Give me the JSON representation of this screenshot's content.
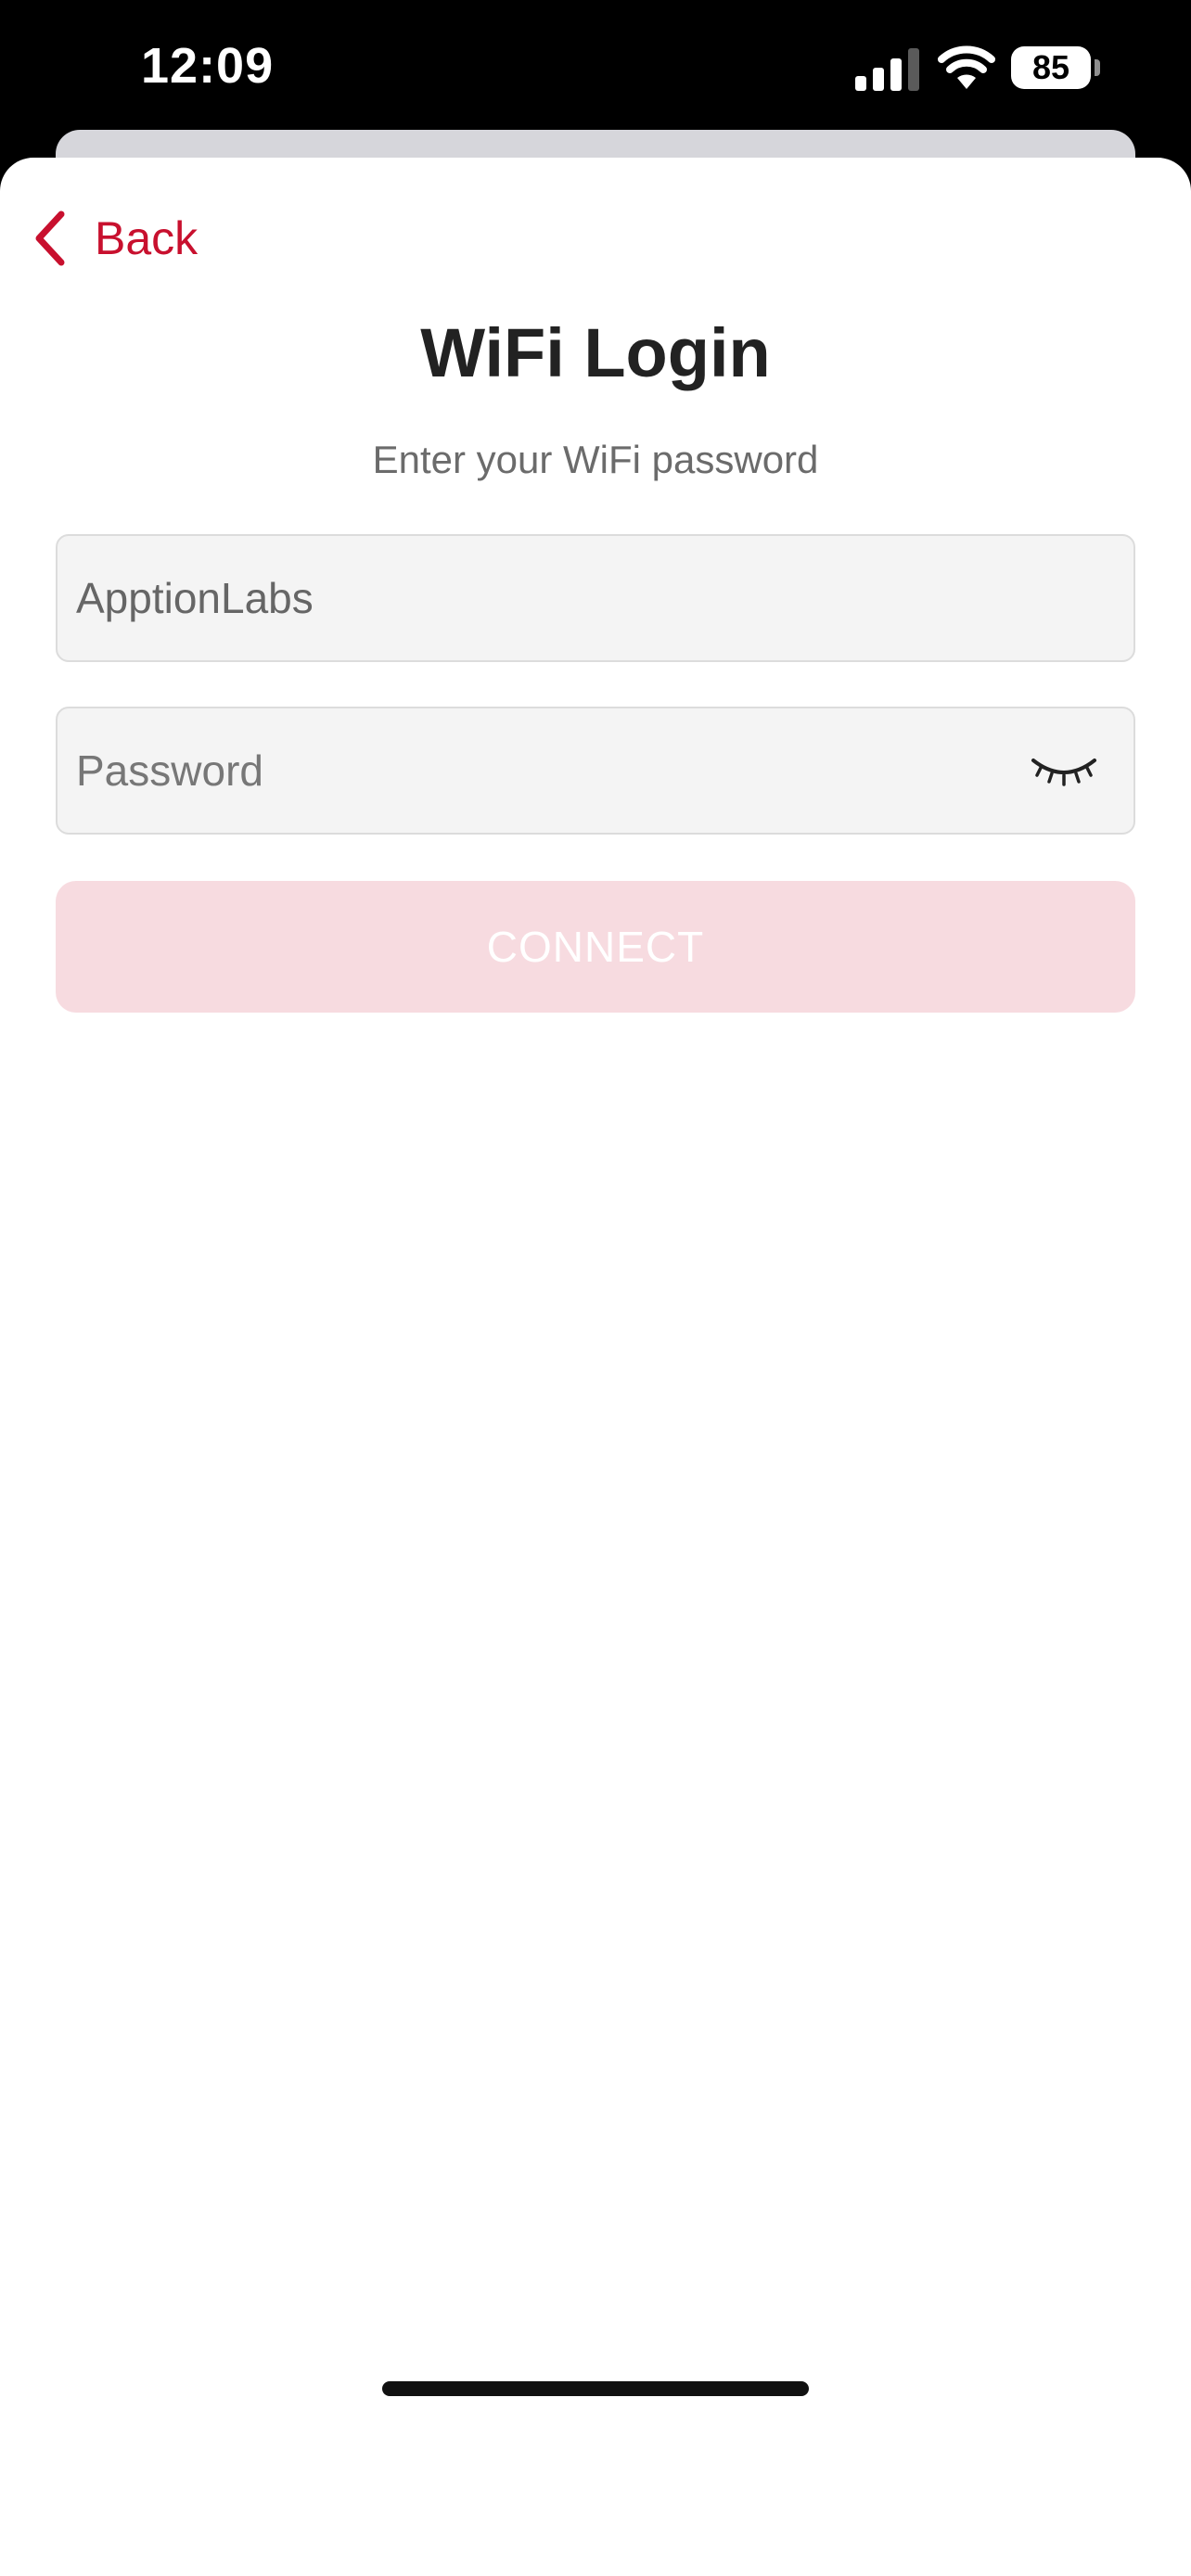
{
  "status_bar": {
    "time": "12:09",
    "battery_level": "85",
    "icons": [
      "signal-icon",
      "wifi-icon",
      "battery-icon"
    ]
  },
  "header": {
    "back_label": "Back",
    "back_icon": "chevron-left-icon"
  },
  "main": {
    "title": "WiFi Login",
    "subtitle": "Enter your WiFi password",
    "ssid_value": "ApptionLabs",
    "password_placeholder": "Password",
    "password_toggle_icon": "eye-closed-icon",
    "connect_label": "CONNECT"
  },
  "colors": {
    "accent": "#c8102e",
    "button_disabled_bg": "#f7dbe0",
    "field_bg": "#f4f4f4",
    "title": "#222222",
    "subtitle": "#6b6b6b"
  }
}
